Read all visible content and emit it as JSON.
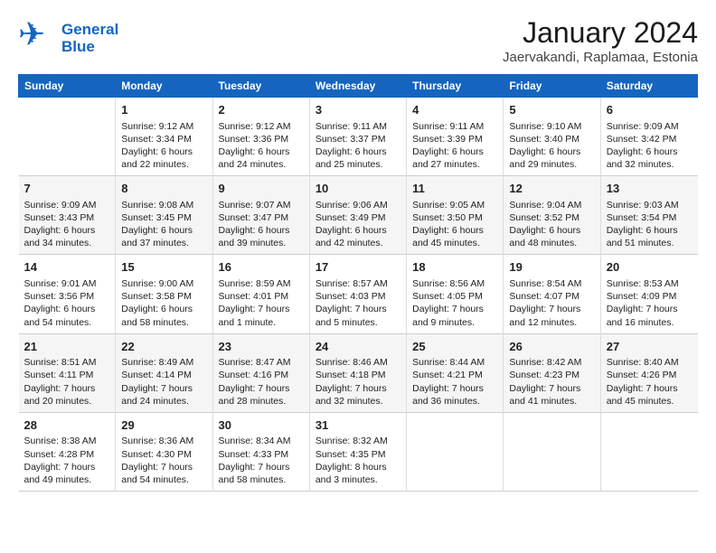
{
  "header": {
    "logo_line1": "General",
    "logo_line2": "Blue",
    "title": "January 2024",
    "subtitle": "Jaervakandi, Raplamaa, Estonia"
  },
  "days_of_week": [
    "Sunday",
    "Monday",
    "Tuesday",
    "Wednesday",
    "Thursday",
    "Friday",
    "Saturday"
  ],
  "weeks": [
    [
      {
        "day": "",
        "sunrise": "",
        "sunset": "",
        "daylight": ""
      },
      {
        "day": "1",
        "sunrise": "Sunrise: 9:12 AM",
        "sunset": "Sunset: 3:34 PM",
        "daylight": "Daylight: 6 hours and 22 minutes."
      },
      {
        "day": "2",
        "sunrise": "Sunrise: 9:12 AM",
        "sunset": "Sunset: 3:36 PM",
        "daylight": "Daylight: 6 hours and 24 minutes."
      },
      {
        "day": "3",
        "sunrise": "Sunrise: 9:11 AM",
        "sunset": "Sunset: 3:37 PM",
        "daylight": "Daylight: 6 hours and 25 minutes."
      },
      {
        "day": "4",
        "sunrise": "Sunrise: 9:11 AM",
        "sunset": "Sunset: 3:39 PM",
        "daylight": "Daylight: 6 hours and 27 minutes."
      },
      {
        "day": "5",
        "sunrise": "Sunrise: 9:10 AM",
        "sunset": "Sunset: 3:40 PM",
        "daylight": "Daylight: 6 hours and 29 minutes."
      },
      {
        "day": "6",
        "sunrise": "Sunrise: 9:09 AM",
        "sunset": "Sunset: 3:42 PM",
        "daylight": "Daylight: 6 hours and 32 minutes."
      }
    ],
    [
      {
        "day": "7",
        "sunrise": "Sunrise: 9:09 AM",
        "sunset": "Sunset: 3:43 PM",
        "daylight": "Daylight: 6 hours and 34 minutes."
      },
      {
        "day": "8",
        "sunrise": "Sunrise: 9:08 AM",
        "sunset": "Sunset: 3:45 PM",
        "daylight": "Daylight: 6 hours and 37 minutes."
      },
      {
        "day": "9",
        "sunrise": "Sunrise: 9:07 AM",
        "sunset": "Sunset: 3:47 PM",
        "daylight": "Daylight: 6 hours and 39 minutes."
      },
      {
        "day": "10",
        "sunrise": "Sunrise: 9:06 AM",
        "sunset": "Sunset: 3:49 PM",
        "daylight": "Daylight: 6 hours and 42 minutes."
      },
      {
        "day": "11",
        "sunrise": "Sunrise: 9:05 AM",
        "sunset": "Sunset: 3:50 PM",
        "daylight": "Daylight: 6 hours and 45 minutes."
      },
      {
        "day": "12",
        "sunrise": "Sunrise: 9:04 AM",
        "sunset": "Sunset: 3:52 PM",
        "daylight": "Daylight: 6 hours and 48 minutes."
      },
      {
        "day": "13",
        "sunrise": "Sunrise: 9:03 AM",
        "sunset": "Sunset: 3:54 PM",
        "daylight": "Daylight: 6 hours and 51 minutes."
      }
    ],
    [
      {
        "day": "14",
        "sunrise": "Sunrise: 9:01 AM",
        "sunset": "Sunset: 3:56 PM",
        "daylight": "Daylight: 6 hours and 54 minutes."
      },
      {
        "day": "15",
        "sunrise": "Sunrise: 9:00 AM",
        "sunset": "Sunset: 3:58 PM",
        "daylight": "Daylight: 6 hours and 58 minutes."
      },
      {
        "day": "16",
        "sunrise": "Sunrise: 8:59 AM",
        "sunset": "Sunset: 4:01 PM",
        "daylight": "Daylight: 7 hours and 1 minute."
      },
      {
        "day": "17",
        "sunrise": "Sunrise: 8:57 AM",
        "sunset": "Sunset: 4:03 PM",
        "daylight": "Daylight: 7 hours and 5 minutes."
      },
      {
        "day": "18",
        "sunrise": "Sunrise: 8:56 AM",
        "sunset": "Sunset: 4:05 PM",
        "daylight": "Daylight: 7 hours and 9 minutes."
      },
      {
        "day": "19",
        "sunrise": "Sunrise: 8:54 AM",
        "sunset": "Sunset: 4:07 PM",
        "daylight": "Daylight: 7 hours and 12 minutes."
      },
      {
        "day": "20",
        "sunrise": "Sunrise: 8:53 AM",
        "sunset": "Sunset: 4:09 PM",
        "daylight": "Daylight: 7 hours and 16 minutes."
      }
    ],
    [
      {
        "day": "21",
        "sunrise": "Sunrise: 8:51 AM",
        "sunset": "Sunset: 4:11 PM",
        "daylight": "Daylight: 7 hours and 20 minutes."
      },
      {
        "day": "22",
        "sunrise": "Sunrise: 8:49 AM",
        "sunset": "Sunset: 4:14 PM",
        "daylight": "Daylight: 7 hours and 24 minutes."
      },
      {
        "day": "23",
        "sunrise": "Sunrise: 8:47 AM",
        "sunset": "Sunset: 4:16 PM",
        "daylight": "Daylight: 7 hours and 28 minutes."
      },
      {
        "day": "24",
        "sunrise": "Sunrise: 8:46 AM",
        "sunset": "Sunset: 4:18 PM",
        "daylight": "Daylight: 7 hours and 32 minutes."
      },
      {
        "day": "25",
        "sunrise": "Sunrise: 8:44 AM",
        "sunset": "Sunset: 4:21 PM",
        "daylight": "Daylight: 7 hours and 36 minutes."
      },
      {
        "day": "26",
        "sunrise": "Sunrise: 8:42 AM",
        "sunset": "Sunset: 4:23 PM",
        "daylight": "Daylight: 7 hours and 41 minutes."
      },
      {
        "day": "27",
        "sunrise": "Sunrise: 8:40 AM",
        "sunset": "Sunset: 4:26 PM",
        "daylight": "Daylight: 7 hours and 45 minutes."
      }
    ],
    [
      {
        "day": "28",
        "sunrise": "Sunrise: 8:38 AM",
        "sunset": "Sunset: 4:28 PM",
        "daylight": "Daylight: 7 hours and 49 minutes."
      },
      {
        "day": "29",
        "sunrise": "Sunrise: 8:36 AM",
        "sunset": "Sunset: 4:30 PM",
        "daylight": "Daylight: 7 hours and 54 minutes."
      },
      {
        "day": "30",
        "sunrise": "Sunrise: 8:34 AM",
        "sunset": "Sunset: 4:33 PM",
        "daylight": "Daylight: 7 hours and 58 minutes."
      },
      {
        "day": "31",
        "sunrise": "Sunrise: 8:32 AM",
        "sunset": "Sunset: 4:35 PM",
        "daylight": "Daylight: 8 hours and 3 minutes."
      },
      {
        "day": "",
        "sunrise": "",
        "sunset": "",
        "daylight": ""
      },
      {
        "day": "",
        "sunrise": "",
        "sunset": "",
        "daylight": ""
      },
      {
        "day": "",
        "sunrise": "",
        "sunset": "",
        "daylight": ""
      }
    ]
  ]
}
